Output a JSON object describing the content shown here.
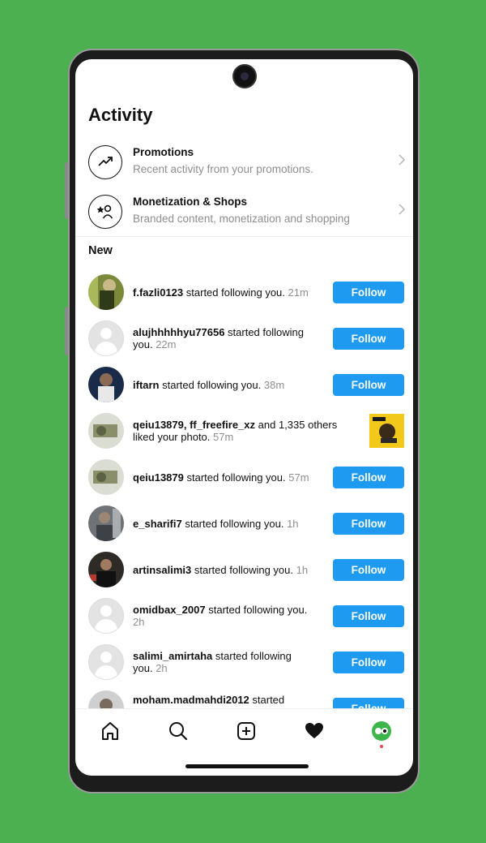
{
  "page": {
    "title": "Activity"
  },
  "menu": [
    {
      "title": "Promotions",
      "subtitle": "Recent activity from your promotions.",
      "icon": "trending-up-icon"
    },
    {
      "title": "Monetization & Shops",
      "subtitle": "Branded content, monetization and shopping",
      "icon": "star-person-icon"
    }
  ],
  "section": {
    "label": "New"
  },
  "notifications": [
    {
      "user": "f.fazli0123",
      "text": " started following you.",
      "time": "21m",
      "action": "Follow",
      "avatar": "photo-green"
    },
    {
      "user": "alujhhhhhyu77656",
      "text": " started following you.",
      "time": "22m",
      "action": "Follow",
      "avatar": "blank"
    },
    {
      "user": "iftarn",
      "text": " started following you.",
      "time": "38m",
      "action": "Follow",
      "avatar": "photo-blue"
    },
    {
      "user": "qeiu13879, ff_freefire_xz",
      "text": " and 1,335 others liked your photo.",
      "time": "57m",
      "action": "",
      "avatar": "photo-camo"
    },
    {
      "user": "qeiu13879",
      "text": " started following you.",
      "time": "57m",
      "action": "Follow",
      "avatar": "photo-camo"
    },
    {
      "user": "e_sharifi7",
      "text": " started following you.",
      "time": "1h",
      "action": "Follow",
      "avatar": "photo-grey"
    },
    {
      "user": "artinsalimi3",
      "text": " started following you.",
      "time": "1h",
      "action": "Follow",
      "avatar": "photo-dark"
    },
    {
      "user": "omidbax_2007",
      "text": " started following you.",
      "time": "2h",
      "action": "Follow",
      "avatar": "blank"
    },
    {
      "user": "salimi_amirtaha",
      "text": " started following you.",
      "time": "2h",
      "action": "Follow",
      "avatar": "blank"
    },
    {
      "user": "moham.madmahdi2012",
      "text": " started",
      "time": "",
      "action": "Follow",
      "avatar": "photo-grey"
    }
  ],
  "nav": [
    "home-icon",
    "search-icon",
    "new-post-icon",
    "activity-heart-icon",
    "profile-avatar-icon"
  ],
  "colors": {
    "accent": "#1e9bf0",
    "background": "#4caf50",
    "muted": "#8e8e8e"
  }
}
